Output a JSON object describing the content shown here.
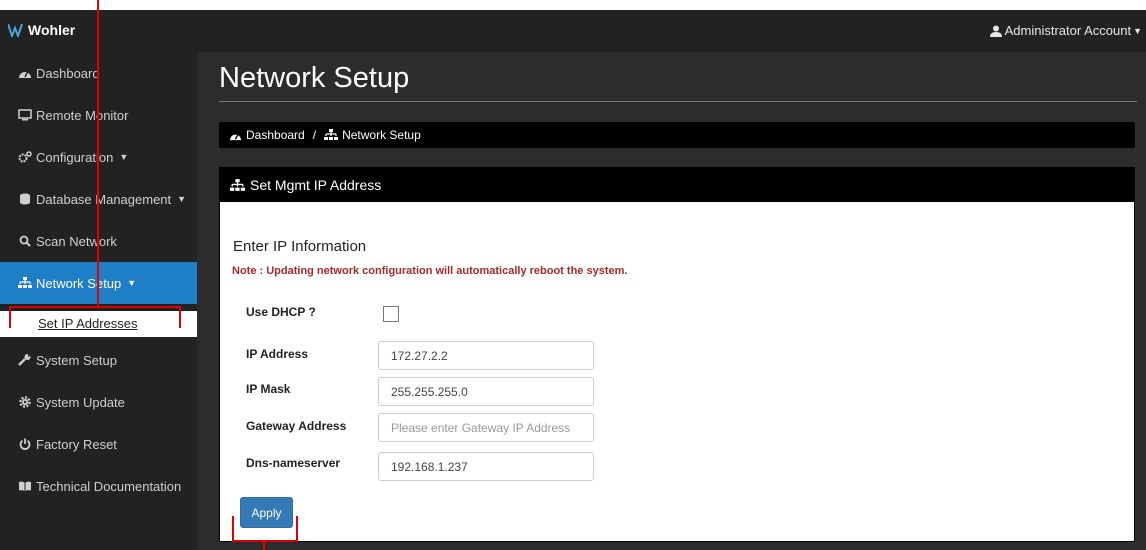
{
  "header": {
    "logo_text": "Wohler",
    "account_label": "Administrator Account"
  },
  "sidebar": {
    "items": [
      {
        "label": "Dashboard",
        "icon": "tachometer-icon"
      },
      {
        "label": "Remote Monitor",
        "icon": "monitor-icon"
      },
      {
        "label": "Configuration",
        "icon": "cogs-icon",
        "has_caret": true
      },
      {
        "label": "Database Management",
        "icon": "database-icon",
        "has_caret": true
      },
      {
        "label": "Scan Network",
        "icon": "search-icon"
      },
      {
        "label": "Network Setup",
        "icon": "sitemap-icon",
        "has_caret": true,
        "active": true
      },
      {
        "label": "System Setup",
        "icon": "wrench-icon"
      },
      {
        "label": "System Update",
        "icon": "gear-icon"
      },
      {
        "label": "Factory Reset",
        "icon": "power-icon"
      },
      {
        "label": "Technical Documentation",
        "icon": "book-icon"
      }
    ],
    "subitem": "Set IP Addresses"
  },
  "main": {
    "title": "Network Setup",
    "breadcrumb": {
      "home": "Dashboard",
      "separator": "/",
      "current": "Network Setup"
    },
    "panel": {
      "heading": "Set Mgmt IP Address",
      "section_title": "Enter IP Information",
      "note": "Note : Updating network configuration will automatically reboot the system.",
      "dhcp_label": "Use DHCP ?",
      "dhcp_checked": false,
      "fields": {
        "ip_address": {
          "label": "IP Address",
          "value": "172.27.2.2",
          "placeholder": ""
        },
        "ip_mask": {
          "label": "IP Mask",
          "value": "255.255.255.0",
          "placeholder": ""
        },
        "gateway": {
          "label": "Gateway Address",
          "value": "",
          "placeholder": "Please enter Gateway IP Address"
        },
        "dns": {
          "label": "Dns-nameserver",
          "value": "192.168.1.237",
          "placeholder": ""
        }
      },
      "apply_label": "Apply"
    }
  },
  "colors": {
    "sidebar_bg": "#222222",
    "active_item": "#1e7fc7",
    "main_bg": "#2c2c2c",
    "note_text": "#a52a2a",
    "apply_button": "#337ab7",
    "annotation_red": "#e00000"
  }
}
